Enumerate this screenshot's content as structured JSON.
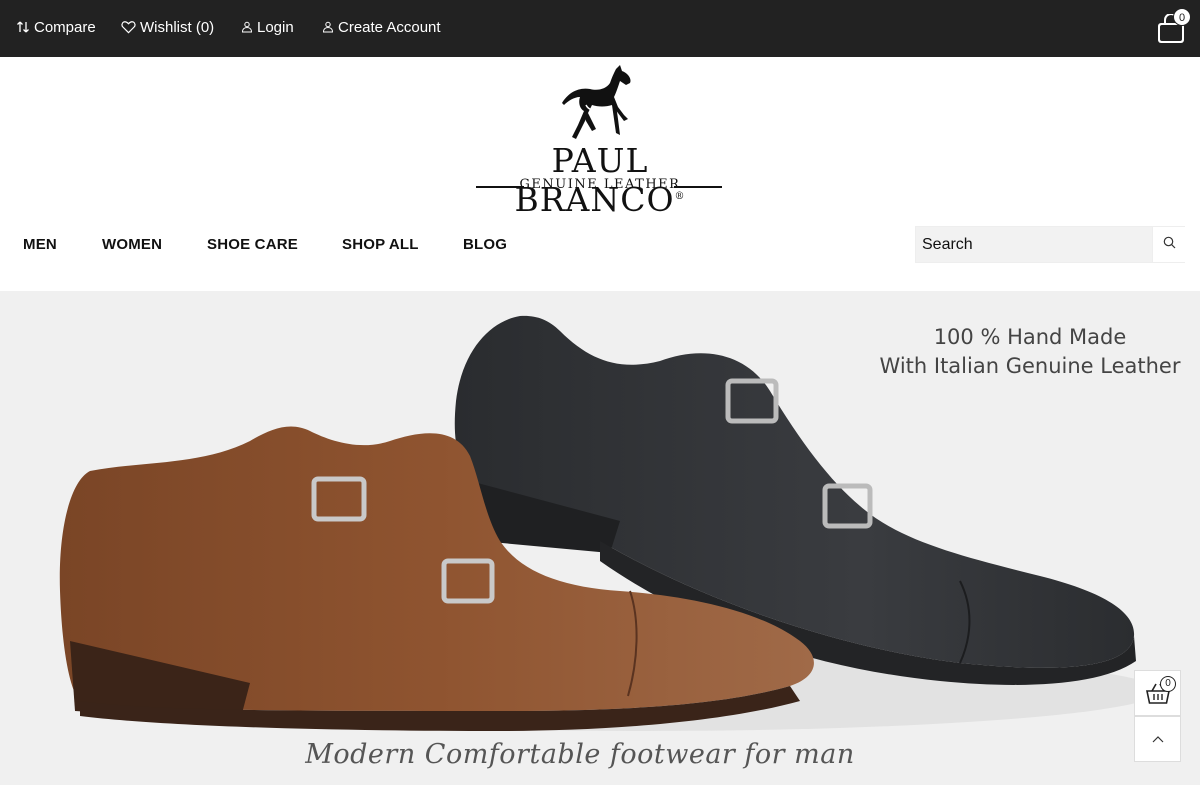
{
  "topbar": {
    "compare": {
      "icon": "sort-arrows-icon",
      "label": "Compare"
    },
    "wishlist": {
      "icon": "heart-icon",
      "label": "Wishlist (0)"
    },
    "login": {
      "icon": "user-icon",
      "label": "Login"
    },
    "create_account": {
      "icon": "user-icon",
      "label": "Create Account"
    },
    "cart": {
      "icon": "shopping-bag-icon",
      "count": "0"
    }
  },
  "logo": {
    "brand": "PAUL BRANCO",
    "registered": "®",
    "tagline": "GENUINE LEATHER",
    "icon": "horse-logo-icon"
  },
  "nav": {
    "items": [
      {
        "label": "MEN"
      },
      {
        "label": "WOMEN"
      },
      {
        "label": "SHOE CARE"
      },
      {
        "label": "SHOP ALL"
      },
      {
        "label": "BLOG"
      }
    ]
  },
  "search": {
    "placeholder": "Search",
    "icon": "search-icon"
  },
  "hero": {
    "title_line1": "100 % Hand Made",
    "title_line2": "With Italian Genuine Leather",
    "caption": "Modern Comfortable footwear for man",
    "image": "double-monk-strap-shoes"
  },
  "floating": {
    "cart": {
      "icon": "basket-icon",
      "count": "0"
    },
    "back_to_top": {
      "icon": "chevron-up-icon"
    }
  },
  "colors": {
    "topbar_bg": "#222222",
    "hero_bg": "#f0f0f0",
    "brown_shoe": "#8a4f2b",
    "black_shoe": "#2e3033"
  }
}
